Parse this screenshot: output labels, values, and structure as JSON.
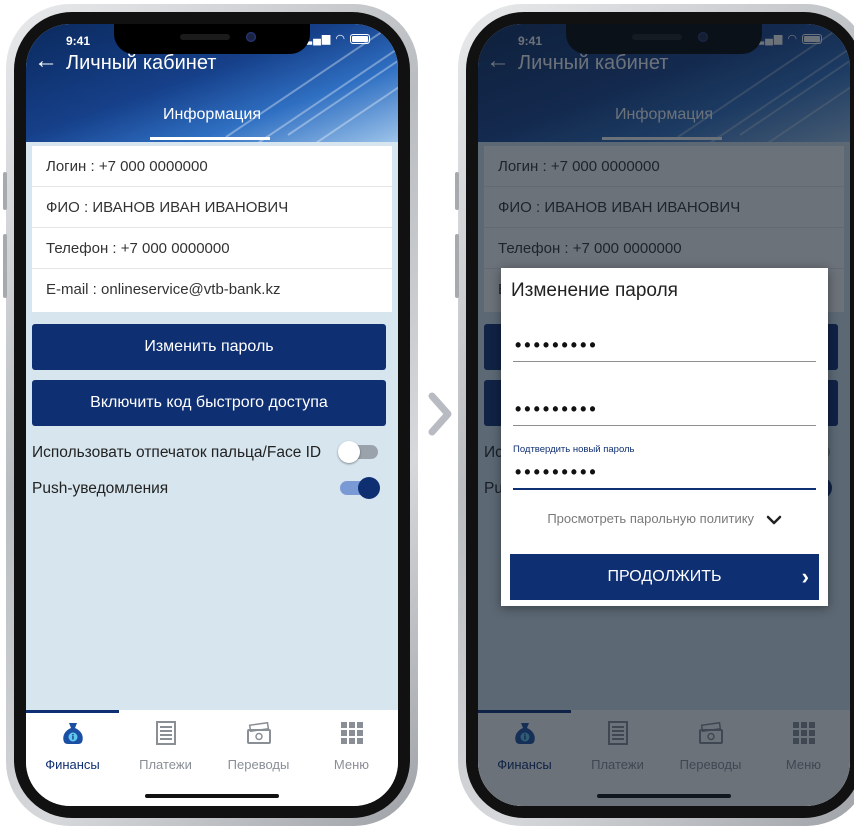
{
  "status_bar": {
    "time": "9:41"
  },
  "header": {
    "back_icon": "arrow-left-icon",
    "title": "Личный кабинет",
    "tab": "Информация"
  },
  "profile": {
    "rows": [
      "Логин : +7 000 0000000",
      "ФИО : ИВАНОВ ИВАН ИВАНОВИЧ",
      "Телефон : +7 000 0000000",
      "E-mail : onlineservice@vtb-bank.kz"
    ]
  },
  "actions": {
    "change_password": "Изменить пароль",
    "enable_quick_access": "Включить код быстрого доступа"
  },
  "settings": {
    "biometric_label": "Использовать отпечаток пальца/Face ID",
    "biometric_enabled": false,
    "push_label": "Push-уведомления",
    "push_enabled": true
  },
  "nav": {
    "items": [
      {
        "label": "Финансы",
        "icon": "moneybag-icon",
        "active": true
      },
      {
        "label": "Платежи",
        "icon": "list-icon",
        "active": false
      },
      {
        "label": "Переводы",
        "icon": "wallet-icon",
        "active": false
      },
      {
        "label": "Меню",
        "icon": "grid-icon",
        "active": false
      }
    ]
  },
  "dialog": {
    "title": "Изменение пароля",
    "field_value": "•••••••••",
    "confirm_label": "Подтвердить новый пароль",
    "policy_link": "Просмотреть парольную политику",
    "continue_label": "ПРОДОЛЖИТЬ"
  },
  "colors": {
    "brand": "#0f2f73",
    "background": "#d6e5ee",
    "overlay": "#121c28"
  }
}
